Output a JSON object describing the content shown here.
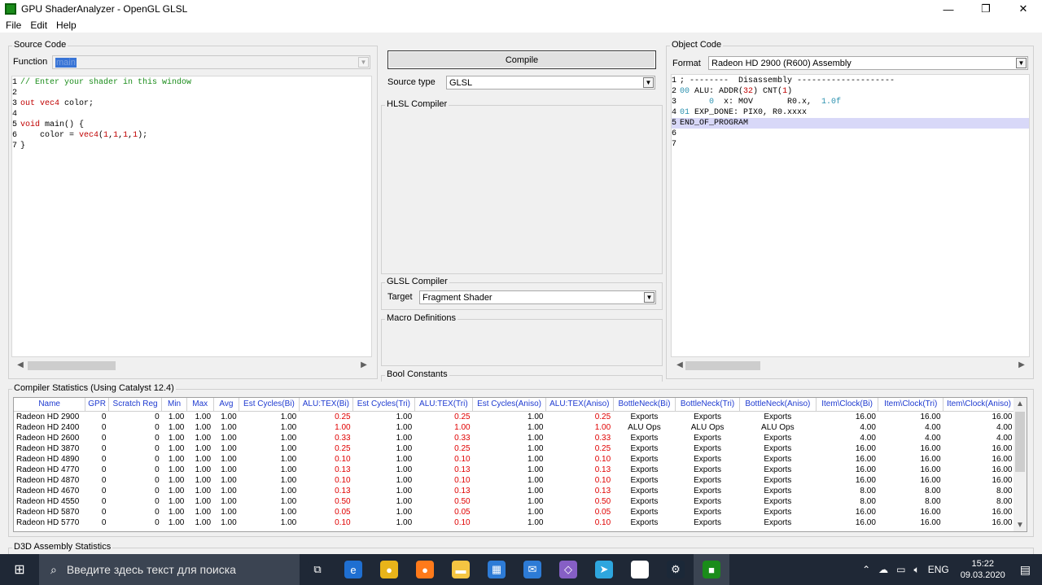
{
  "window": {
    "title": "GPU ShaderAnalyzer - OpenGL GLSL",
    "minimize": "—",
    "maximize": "❐",
    "close": "✕"
  },
  "menu": [
    "File",
    "Edit",
    "Help"
  ],
  "source": {
    "group_label": "Source Code",
    "function_label": "Function",
    "function_value": "main",
    "lines": [
      {
        "n": "1",
        "segments": [
          {
            "t": "// Enter your shader in this window",
            "c": "comment"
          }
        ]
      },
      {
        "n": "2",
        "segments": []
      },
      {
        "n": "3",
        "segments": [
          {
            "t": "out vec4",
            "c": "kw"
          },
          {
            "t": " color;",
            "c": ""
          }
        ]
      },
      {
        "n": "4",
        "segments": []
      },
      {
        "n": "5",
        "segments": [
          {
            "t": "void",
            "c": "kw"
          },
          {
            "t": " main() {",
            "c": ""
          }
        ]
      },
      {
        "n": "6",
        "segments": [
          {
            "t": "    color = ",
            "c": ""
          },
          {
            "t": "vec4",
            "c": "kw"
          },
          {
            "t": "(",
            "c": ""
          },
          {
            "t": "1",
            "c": "num"
          },
          {
            "t": ",",
            "c": ""
          },
          {
            "t": "1",
            "c": "num"
          },
          {
            "t": ",",
            "c": ""
          },
          {
            "t": "1",
            "c": "num"
          },
          {
            "t": ",",
            "c": ""
          },
          {
            "t": "1",
            "c": "num"
          },
          {
            "t": ");",
            "c": ""
          }
        ]
      },
      {
        "n": "7",
        "segments": [
          {
            "t": "}",
            "c": ""
          }
        ]
      }
    ]
  },
  "middle": {
    "compile_label": "Compile",
    "source_type_label": "Source type",
    "source_type_value": "GLSL",
    "hlsl_label": "HLSL Compiler",
    "glsl_label": "GLSL Compiler",
    "target_label": "Target",
    "target_value": "Fragment Shader",
    "macro_label": "Macro Definitions",
    "bool_label": "Bool Constants"
  },
  "object": {
    "group_label": "Object Code",
    "format_label": "Format",
    "format_value": "Radeon HD 2900 (R600) Assembly",
    "lines": [
      {
        "n": "1",
        "segments": [
          {
            "t": "; --------  Disassembly --------------------",
            "c": ""
          }
        ]
      },
      {
        "n": "2",
        "segments": [
          {
            "t": "00",
            "c": "hex"
          },
          {
            "t": " ALU: ADDR(",
            "c": ""
          },
          {
            "t": "32",
            "c": "num"
          },
          {
            "t": ") CNT(",
            "c": ""
          },
          {
            "t": "1",
            "c": "num"
          },
          {
            "t": ")",
            "c": ""
          }
        ]
      },
      {
        "n": "3",
        "segments": [
          {
            "t": "      0",
            "c": "hex"
          },
          {
            "t": "  x: MOV       R0.x,  ",
            "c": ""
          },
          {
            "t": "1.0f",
            "c": "hex"
          }
        ]
      },
      {
        "n": "4",
        "segments": [
          {
            "t": "01",
            "c": "hex"
          },
          {
            "t": " EXP_DONE: PIX0, R0.xxxx",
            "c": ""
          }
        ]
      },
      {
        "n": "5",
        "segments": [
          {
            "t": "END_OF_PROGRAM",
            "c": ""
          }
        ],
        "hl": true
      },
      {
        "n": "6",
        "segments": []
      },
      {
        "n": "7",
        "segments": []
      }
    ]
  },
  "stats": {
    "group_label": "Compiler Statistics (Using Catalyst 12.4)",
    "columns": [
      "Name",
      "GPR",
      "Scratch Reg",
      "Min",
      "Max",
      "Avg",
      "Est Cycles(Bi)",
      "ALU:TEX(Bi)",
      "Est Cycles(Tri)",
      "ALU:TEX(Tri)",
      "Est Cycles(Aniso)",
      "ALU:TEX(Aniso)",
      "BottleNeck(Bi)",
      "BottleNeck(Tri)",
      "BottleNeck(Aniso)",
      "Item\\Clock(Bi)",
      "Item\\Clock(Tri)",
      "Item\\Clock(Aniso)"
    ],
    "rows": [
      [
        "Radeon HD 2900",
        "0",
        "0",
        "1.00",
        "1.00",
        "1.00",
        "1.00",
        "0.25",
        "1.00",
        "0.25",
        "1.00",
        "0.25",
        "Exports",
        "Exports",
        "Exports",
        "16.00",
        "16.00",
        "16.00"
      ],
      [
        "Radeon HD 2400",
        "0",
        "0",
        "1.00",
        "1.00",
        "1.00",
        "1.00",
        "1.00",
        "1.00",
        "1.00",
        "1.00",
        "1.00",
        "ALU Ops",
        "ALU Ops",
        "ALU Ops",
        "4.00",
        "4.00",
        "4.00"
      ],
      [
        "Radeon HD 2600",
        "0",
        "0",
        "1.00",
        "1.00",
        "1.00",
        "1.00",
        "0.33",
        "1.00",
        "0.33",
        "1.00",
        "0.33",
        "Exports",
        "Exports",
        "Exports",
        "4.00",
        "4.00",
        "4.00"
      ],
      [
        "Radeon HD 3870",
        "0",
        "0",
        "1.00",
        "1.00",
        "1.00",
        "1.00",
        "0.25",
        "1.00",
        "0.25",
        "1.00",
        "0.25",
        "Exports",
        "Exports",
        "Exports",
        "16.00",
        "16.00",
        "16.00"
      ],
      [
        "Radeon HD 4890",
        "0",
        "0",
        "1.00",
        "1.00",
        "1.00",
        "1.00",
        "0.10",
        "1.00",
        "0.10",
        "1.00",
        "0.10",
        "Exports",
        "Exports",
        "Exports",
        "16.00",
        "16.00",
        "16.00"
      ],
      [
        "Radeon HD 4770",
        "0",
        "0",
        "1.00",
        "1.00",
        "1.00",
        "1.00",
        "0.13",
        "1.00",
        "0.13",
        "1.00",
        "0.13",
        "Exports",
        "Exports",
        "Exports",
        "16.00",
        "16.00",
        "16.00"
      ],
      [
        "Radeon HD 4870",
        "0",
        "0",
        "1.00",
        "1.00",
        "1.00",
        "1.00",
        "0.10",
        "1.00",
        "0.10",
        "1.00",
        "0.10",
        "Exports",
        "Exports",
        "Exports",
        "16.00",
        "16.00",
        "16.00"
      ],
      [
        "Radeon HD 4670",
        "0",
        "0",
        "1.00",
        "1.00",
        "1.00",
        "1.00",
        "0.13",
        "1.00",
        "0.13",
        "1.00",
        "0.13",
        "Exports",
        "Exports",
        "Exports",
        "8.00",
        "8.00",
        "8.00"
      ],
      [
        "Radeon HD 4550",
        "0",
        "0",
        "1.00",
        "1.00",
        "1.00",
        "1.00",
        "0.50",
        "1.00",
        "0.50",
        "1.00",
        "0.50",
        "Exports",
        "Exports",
        "Exports",
        "8.00",
        "8.00",
        "8.00"
      ],
      [
        "Radeon HD 5870",
        "0",
        "0",
        "1.00",
        "1.00",
        "1.00",
        "1.00",
        "0.05",
        "1.00",
        "0.05",
        "1.00",
        "0.05",
        "Exports",
        "Exports",
        "Exports",
        "16.00",
        "16.00",
        "16.00"
      ],
      [
        "Radeon HD 5770",
        "0",
        "0",
        "1.00",
        "1.00",
        "1.00",
        "1.00",
        "0.10",
        "1.00",
        "0.10",
        "1.00",
        "0.10",
        "Exports",
        "Exports",
        "Exports",
        "16.00",
        "16.00",
        "16.00"
      ]
    ]
  },
  "d3d_label": "D3D Assembly Statistics",
  "taskbar": {
    "search_placeholder": "Введите здесь текст для поиска",
    "lang": "ENG",
    "time": "15:22",
    "date": "09.03.2020",
    "icons": [
      {
        "name": "task-view-icon",
        "color": "#1f2836",
        "glyph": "⧉"
      },
      {
        "name": "edge-icon",
        "color": "#1f6fd1",
        "glyph": "e"
      },
      {
        "name": "chrome-icon",
        "color": "#e8b41a",
        "glyph": "●"
      },
      {
        "name": "firefox-icon",
        "color": "#ff7a1a",
        "glyph": "●"
      },
      {
        "name": "file-explorer-icon",
        "color": "#f5c542",
        "glyph": "▬"
      },
      {
        "name": "store-icon",
        "color": "#2d7bd6",
        "glyph": "▦"
      },
      {
        "name": "mail-icon",
        "color": "#2d7bd6",
        "glyph": "✉"
      },
      {
        "name": "visual-studio-icon",
        "color": "#865fc5",
        "glyph": "◇"
      },
      {
        "name": "telegram-icon",
        "color": "#2ea6de",
        "glyph": "➤"
      },
      {
        "name": "slack-icon",
        "color": "#ffffff",
        "glyph": "✱"
      },
      {
        "name": "steam-icon",
        "color": "#1b2838",
        "glyph": "⚙"
      },
      {
        "name": "shaderanalyzer-task-icon",
        "color": "#1a8c1a",
        "glyph": "■"
      }
    ]
  }
}
